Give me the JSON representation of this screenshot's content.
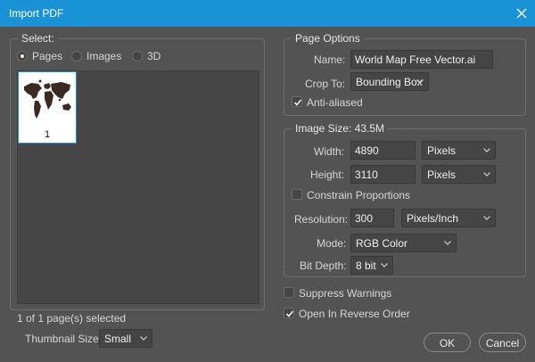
{
  "window": {
    "title": "Import PDF"
  },
  "select_panel": {
    "legend": "Select:",
    "options": [
      {
        "label": "Pages",
        "selected": true
      },
      {
        "label": "Images",
        "selected": false
      },
      {
        "label": "3D",
        "selected": false
      }
    ],
    "thumbnail": {
      "page_number": "1"
    },
    "status": "1 of 1 page(s) selected",
    "thumbnail_size_label": "Thumbnail Size:",
    "thumbnail_size_value": "Small"
  },
  "page_options": {
    "legend": "Page Options",
    "name_label": "Name:",
    "name_value": "World Map Free Vector.ai",
    "crop_label": "Crop To:",
    "crop_value": "Bounding Box",
    "anti_aliased_label": "Anti-aliased",
    "anti_aliased_checked": true
  },
  "image_size": {
    "legend": "Image Size: 43.5M",
    "width_label": "Width:",
    "width_value": "4890",
    "width_unit": "Pixels",
    "height_label": "Height:",
    "height_value": "3110",
    "height_unit": "Pixels",
    "constrain_label": "Constrain Proportions",
    "constrain_checked": false,
    "resolution_label": "Resolution:",
    "resolution_value": "300",
    "resolution_unit": "Pixels/Inch",
    "mode_label": "Mode:",
    "mode_value": "RGB Color",
    "bitdepth_label": "Bit Depth:",
    "bitdepth_value": "8 bit"
  },
  "bottom_options": {
    "suppress_label": "Suppress Warnings",
    "suppress_checked": false,
    "reverse_label": "Open In Reverse Order",
    "reverse_checked": true
  },
  "buttons": {
    "ok": "OK",
    "cancel": "Cancel"
  },
  "colors": {
    "titlebar": "#1a93d6",
    "panel": "#535353",
    "field": "#454545",
    "thumb_border": "#1a93d6"
  },
  "icons": {
    "close": "close-icon",
    "check": "checkmark-icon",
    "dropdown": "chevron-down-icon"
  }
}
